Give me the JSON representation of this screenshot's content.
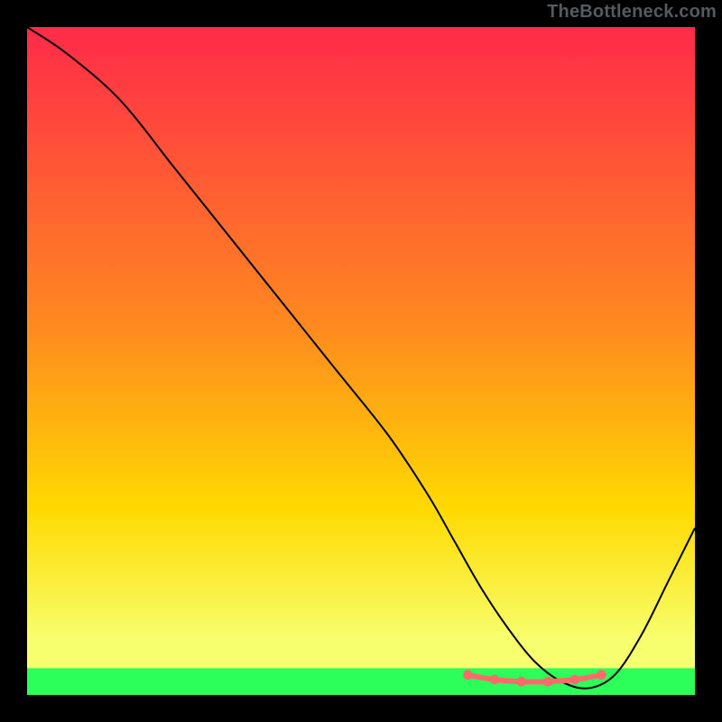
{
  "watermark": {
    "text": "TheBottleneck.com"
  },
  "chart_data": {
    "type": "line",
    "title": "",
    "xlabel": "",
    "ylabel": "",
    "x_range": [
      0,
      100
    ],
    "y_range": [
      0,
      100
    ],
    "grid": false,
    "legend": null,
    "annotations": [],
    "background_gradient": {
      "top_color": "#ff2a49",
      "mid_color": "#ffd900",
      "green_band_color": "#2cff5a",
      "green_band_y_range": [
        0,
        4
      ]
    },
    "series": [
      {
        "name": "main-curve",
        "color": "#000000",
        "stroke_width": 2,
        "x": [
          0,
          6,
          14,
          22,
          30,
          38,
          46,
          54,
          60,
          64,
          68,
          72,
          76,
          80,
          84,
          88,
          92,
          96,
          100
        ],
        "values": [
          100,
          96,
          89,
          79,
          69,
          59,
          49,
          39,
          30,
          23,
          16,
          10,
          5,
          2,
          1,
          3,
          9,
          17,
          25
        ]
      },
      {
        "name": "flat-highlight",
        "color": "#ff6a6a",
        "stroke_width": 6,
        "stroke_linecap": "round",
        "x": [
          66,
          70,
          74,
          78,
          82,
          86
        ],
        "values": [
          3.0,
          2.3,
          2.0,
          2.0,
          2.3,
          3.0
        ]
      }
    ]
  }
}
